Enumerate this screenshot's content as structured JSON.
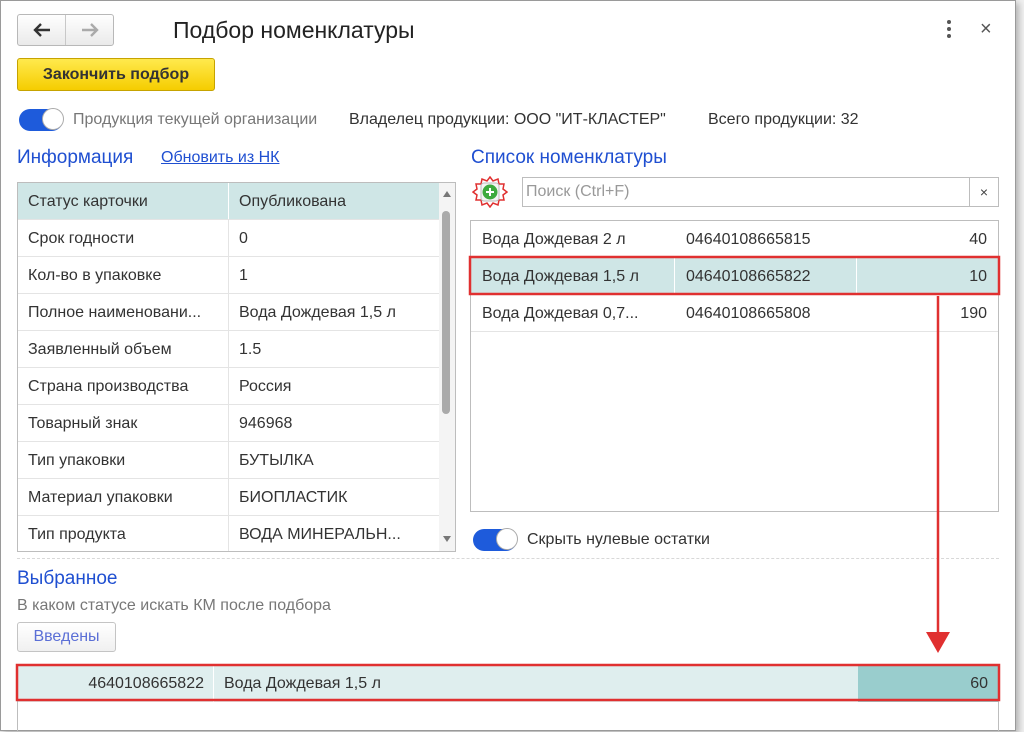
{
  "window": {
    "title": "Подбор номенклатуры",
    "finish_button": "Закончить подбор"
  },
  "filter": {
    "own_products_label": "Продукция текущей организации",
    "owner_text": "Владелец продукции: ООО \"ИТ-КЛАСТЕР\"",
    "total_text": "Всего продукции: 32"
  },
  "info": {
    "title": "Информация",
    "refresh_link": "Обновить из НК",
    "rows": [
      {
        "key": "Статус карточки",
        "value": "Опубликована"
      },
      {
        "key": "Срок годности",
        "value": "0"
      },
      {
        "key": "Кол-во в упаковке",
        "value": "1"
      },
      {
        "key": "Полное наименовани...",
        "value": "Вода Дождевая 1,5 л"
      },
      {
        "key": "Заявленный объем",
        "value": "1.5"
      },
      {
        "key": "Страна производства",
        "value": "Россия"
      },
      {
        "key": "Товарный знак",
        "value": "946968"
      },
      {
        "key": "Тип упаковки",
        "value": "БУТЫЛКА"
      },
      {
        "key": "Материал упаковки",
        "value": "БИОПЛАСТИК"
      },
      {
        "key": "Тип продукта",
        "value": "ВОДА МИНЕРАЛЬН..."
      }
    ]
  },
  "nomenclature": {
    "title": "Список номенклатуры",
    "search_placeholder": "Поиск (Ctrl+F)",
    "clear_icon": "×",
    "rows": [
      {
        "name": "Вода Дождевая 2 л",
        "code": "04640108665815",
        "qty": "40"
      },
      {
        "name": "Вода Дождевая 1,5 л",
        "code": "04640108665822",
        "qty": "10"
      },
      {
        "name": "Вода Дождевая 0,7...",
        "code": "04640108665808",
        "qty": "190"
      }
    ],
    "hide_zero_label": "Скрыть нулевые остатки"
  },
  "selected": {
    "title": "Выбранное",
    "status_prompt": "В каком статусе искать КМ после подбора",
    "status_button": "Введены",
    "rows": [
      {
        "code": "4640108665822",
        "name": "Вода Дождевая 1,5 л",
        "qty": "60"
      }
    ]
  },
  "colors": {
    "accent_blue": "#1f4fd1",
    "highlight_red": "#e03030",
    "selected_row": "#cfe6e6",
    "button_yellow": "#f5cd00"
  }
}
